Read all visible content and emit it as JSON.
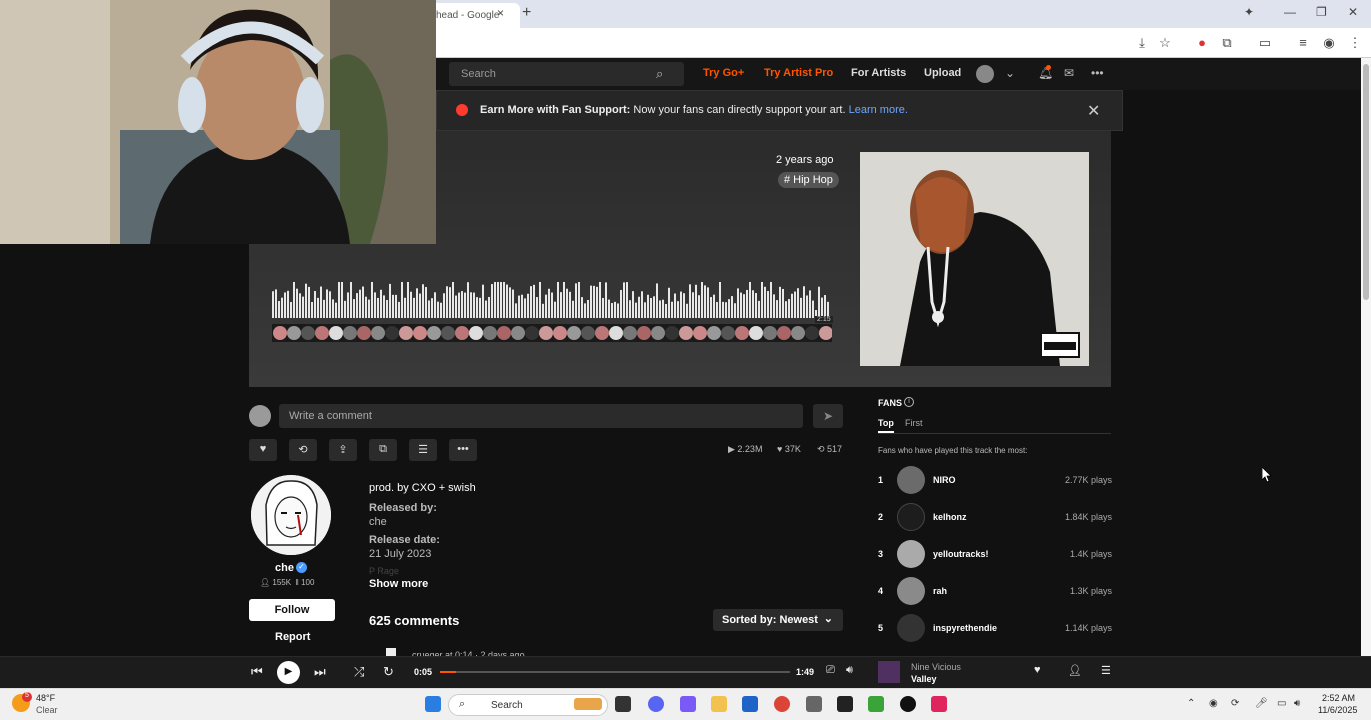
{
  "browser": {
    "tab_title": "head - Google",
    "tab_close": "×",
    "new_tab": "+"
  },
  "site_header": {
    "search_placeholder": "Search",
    "try_go": "Try Go+",
    "try_artist_pro": "Try Artist Pro",
    "for_artists": "For Artists",
    "upload": "Upload",
    "more": "•••"
  },
  "banner": {
    "bold": "Earn More with Fan Support:",
    "text": " Now your fans can directly support your art. ",
    "link": "Learn more.",
    "close": "✕"
  },
  "track": {
    "posted": "2 years ago",
    "tag": "# Hip Hop",
    "waveform_end_time": "2:15"
  },
  "comment_box": {
    "placeholder": "Write a comment"
  },
  "stats": {
    "plays": "2.23M",
    "likes": "37K",
    "reposts": "517"
  },
  "artist": {
    "name": "che",
    "followers": "155K",
    "tracks": "100",
    "follow": "Follow",
    "report": "Report"
  },
  "description": {
    "prod": "prod. by CXO + swish",
    "released_by_label": "Released by:",
    "released_by": "che",
    "release_date_label": "Release date:",
    "release_date": "21 July 2023",
    "fade": "P  Rage",
    "show_more": "Show more"
  },
  "comments": {
    "count": "625 comments",
    "sort": "Sorted by: Newest",
    "peek": "crueger at 0:14 · 2 days ago"
  },
  "fans": {
    "title": "FANS",
    "tab_top": "Top",
    "tab_first": "First",
    "subtitle": "Fans who have played this track the most:",
    "list": [
      {
        "rank": "1",
        "name": "NIRO",
        "plays": "2.77K plays"
      },
      {
        "rank": "2",
        "name": "kelhonz",
        "plays": "1.84K plays"
      },
      {
        "rank": "3",
        "name": "yelloutracks!",
        "plays": "1.4K plays"
      },
      {
        "rank": "4",
        "name": "rah",
        "plays": "1.3K plays"
      },
      {
        "rank": "5",
        "name": "inspyrethendie",
        "plays": "1.14K plays"
      }
    ]
  },
  "player": {
    "position": "0:05",
    "duration": "1:49",
    "progress": 0.046,
    "now_playing_artist": "Nine Vicious",
    "now_playing_title": "Valley"
  },
  "taskbar": {
    "temp": "48°F",
    "condition": "Clear",
    "badge": "5",
    "search": "Search",
    "time": "2:52 AM",
    "date": "11/6/2025"
  },
  "colors": {
    "accent": "#ff5500",
    "link": "#6fa6ff"
  }
}
